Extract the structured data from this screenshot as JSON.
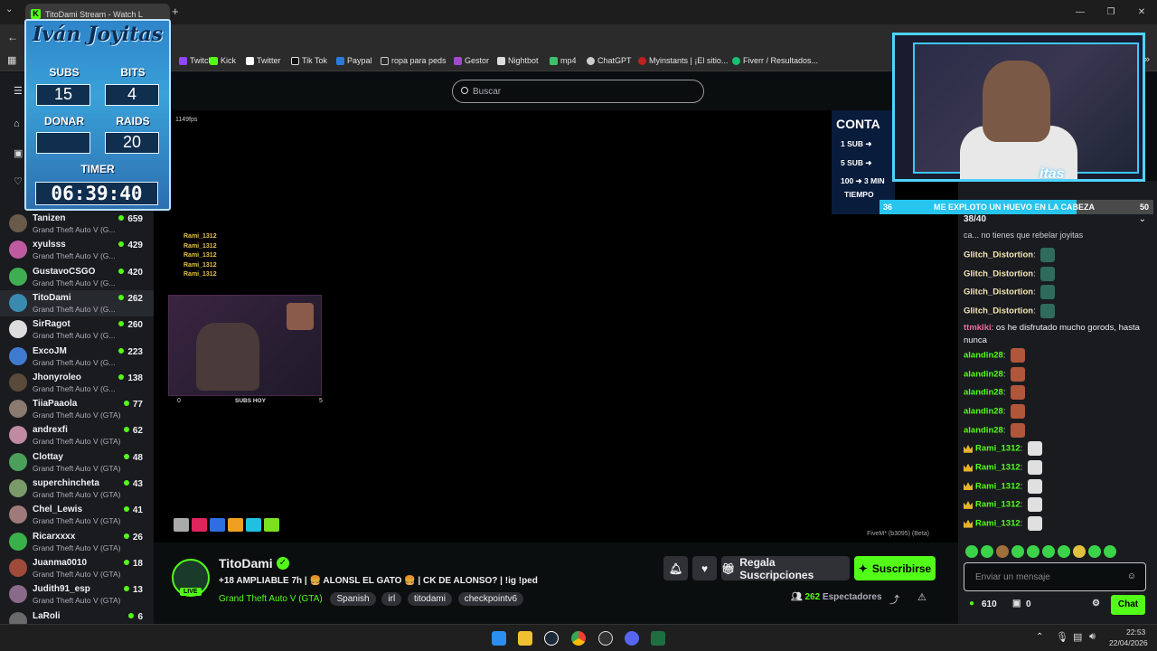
{
  "browser": {
    "tab_title": "TitoDami Stream - Watch L",
    "bookmarks": [
      "Twitch",
      "Kick",
      "Twitter",
      "Tik Tok",
      "Paypal",
      "ropa para peds",
      "Gestor",
      "Nightbot",
      "mp4",
      "ChatGPT",
      "Myinstants | ¡El sitio...",
      "Fiverr / Resultados..."
    ],
    "window_controls": [
      "—",
      "❐",
      "✕"
    ]
  },
  "header": {
    "search_placeholder": "Buscar"
  },
  "stats_overlay": {
    "title": "Iván Joyitas",
    "subs_label": "SUBS",
    "subs_value": "15",
    "bits_label": "BITS",
    "bits_value": "4",
    "donar_label": "DONAR",
    "donar_value": "",
    "raids_label": "RAIDS",
    "raids_value": "20",
    "timer_label": "TIMER",
    "timer_value": "06:39:40"
  },
  "counter_panel": {
    "title": "CONTA",
    "lines": [
      "1 SUB ➜",
      "5 SUB ➜",
      "100 ➜ 3 MIN",
      "TIEMPO"
    ]
  },
  "goal": {
    "start": "36",
    "text": "ME EXPLOTO UN HUEVO EN LA CABEZA",
    "end": "50",
    "progress": 0.72
  },
  "chat_progress": "38/40",
  "webcam_tag": "itas",
  "video": {
    "fps": "1149fps",
    "rami_lines": [
      "Rami_1312",
      "Rami_1312",
      "Rami_1312",
      "Rami_1312",
      "Rami_1312"
    ],
    "subs_hoy_label": "SUBS HOY",
    "subs_hoy_left": "0",
    "subs_hoy_right": "5",
    "fivem": "FiveM* (b3095) (Beta)"
  },
  "sidebar": {
    "channels": [
      {
        "name": "Tanizen",
        "game": "Grand Theft Auto V (G...",
        "viewers": "659",
        "color": "#6a5a4a"
      },
      {
        "name": "xyulsss",
        "game": "Grand Theft Auto V (G...",
        "viewers": "429",
        "color": "#c05aa0"
      },
      {
        "name": "GustavoCSGO",
        "game": "Grand Theft Auto V (G...",
        "viewers": "420",
        "color": "#3fae52"
      },
      {
        "name": "TitoDami",
        "game": "Grand Theft Auto V (G...",
        "viewers": "262",
        "color": "#3a8ab0"
      },
      {
        "name": "SirRagot",
        "game": "Grand Theft Auto V (G...",
        "viewers": "260",
        "color": "#dddddd"
      },
      {
        "name": "ExcoJM",
        "game": "Grand Theft Auto V (G...",
        "viewers": "223",
        "color": "#3f7ad0"
      },
      {
        "name": "Jhonyroleo",
        "game": "Grand Theft Auto V (G...",
        "viewers": "138",
        "color": "#5a4a3a"
      },
      {
        "name": "TiiaPaaola",
        "game": "Grand Theft Auto V (GTA)",
        "viewers": "77",
        "color": "#8a7a70"
      },
      {
        "name": "andrexfi",
        "game": "Grand Theft Auto V (GTA)",
        "viewers": "62",
        "color": "#c08aa0"
      },
      {
        "name": "Clottay",
        "game": "Grand Theft Auto V (GTA)",
        "viewers": "48",
        "color": "#4aa05a"
      },
      {
        "name": "superchincheta",
        "game": "Grand Theft Auto V (GTA)",
        "viewers": "43",
        "color": "#7a9a6a"
      },
      {
        "name": "Chel_Lewis",
        "game": "Grand Theft Auto V (GTA)",
        "viewers": "41",
        "color": "#a07a7a"
      },
      {
        "name": "Ricarxxxx",
        "game": "Grand Theft Auto V (GTA)",
        "viewers": "26",
        "color": "#3ab04a"
      },
      {
        "name": "Juanma0010",
        "game": "Grand Theft Auto V (GTA)",
        "viewers": "18",
        "color": "#a04a3a"
      },
      {
        "name": "Judith91_esp",
        "game": "Grand Theft Auto V (GTA)",
        "viewers": "13",
        "color": "#8a6a8a"
      },
      {
        "name": "LaRoli",
        "game": "",
        "viewers": "6",
        "color": "#6a6a6a"
      }
    ]
  },
  "chat": {
    "partial_top": "ca... no tienes que rebelar joyitas",
    "messages": [
      {
        "user": "Glitch_Distortion",
        "text": "",
        "color": "#f5e6b3",
        "emote": "#2e6b5a"
      },
      {
        "user": "Glitch_Distortion",
        "text": "",
        "color": "#f5e6b3",
        "emote": "#2e6b5a"
      },
      {
        "user": "Glitch_Distortion",
        "text": "",
        "color": "#f5e6b3",
        "emote": "#2e6b5a"
      },
      {
        "user": "Glitch_Distortion",
        "text": "",
        "color": "#f5e6b3",
        "emote": "#2e6b5a"
      },
      {
        "user": "ttmklki",
        "text": "os he disfrutado mucho gorods, hasta",
        "color": "#e86f98",
        "emote": ""
      },
      {
        "user": "",
        "text": "nunca",
        "color": "#e86f98",
        "emote": ""
      },
      {
        "user": "alandin28",
        "text": "",
        "color": "#53fc18",
        "emote": "#b0563a"
      },
      {
        "user": "alandin28",
        "text": "",
        "color": "#53fc18",
        "emote": "#b0563a"
      },
      {
        "user": "alandin28",
        "text": "",
        "color": "#53fc18",
        "emote": "#b0563a"
      },
      {
        "user": "alandin28",
        "text": "",
        "color": "#53fc18",
        "emote": "#b0563a"
      },
      {
        "user": "alandin28",
        "text": "",
        "color": "#53fc18",
        "emote": "#b0563a"
      },
      {
        "user": "Rami_1312",
        "text": "",
        "color": "#53fc18",
        "emote": "#e0e0e0",
        "crown": true
      },
      {
        "user": "Rami_1312",
        "text": "",
        "color": "#53fc18",
        "emote": "#e0e0e0",
        "crown": true
      },
      {
        "user": "Rami_1312",
        "text": "",
        "color": "#53fc18",
        "emote": "#e0e0e0",
        "crown": true
      },
      {
        "user": "Rami_1312",
        "text": "",
        "color": "#53fc18",
        "emote": "#e0e0e0",
        "crown": true
      },
      {
        "user": "Rami_1312",
        "text": "",
        "color": "#53fc18",
        "emote": "#e0e0e0",
        "crown": true
      }
    ],
    "input_placeholder": "Enviar un mensaje",
    "points": "610",
    "drops": "0",
    "chat_button": "Chat"
  },
  "stream_info": {
    "channel_name": "TitoDami",
    "title": "+18 AMPLIABLE 7h | 🍔 ALONSL EL GATO 🍔 | CK DE ALONSO? | !ig !ped",
    "category": "Grand Theft Auto V (GTA)",
    "tags": [
      "Spanish",
      "irl",
      "titodami",
      "checkpointv6"
    ],
    "live_badge": "LIVE",
    "gift_button": "Regala Suscripciones",
    "subscribe_button": "Suscribirse",
    "viewers": "262",
    "viewers_label": "Espectadores"
  },
  "taskbar": {
    "time": "22:53",
    "date": "22/04/2026"
  },
  "colors": {
    "kick_green": "#53fc18",
    "bg": "#0b0e0f",
    "sidebar": "#191b1f"
  }
}
